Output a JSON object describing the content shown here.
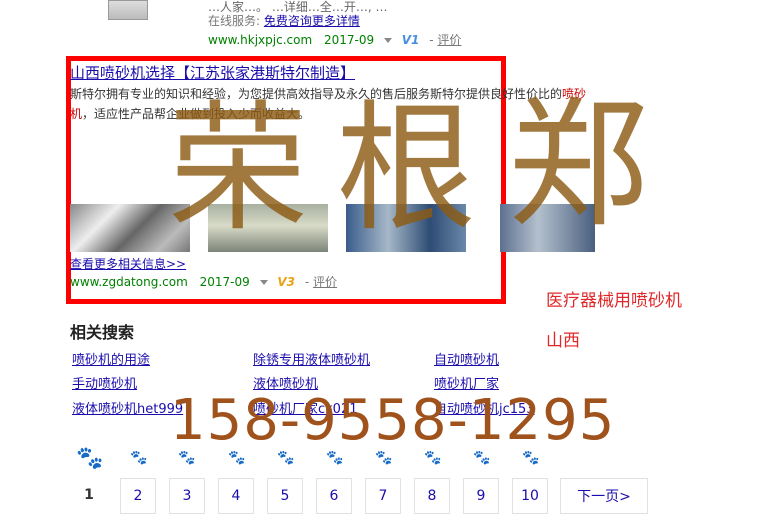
{
  "top_result": {
    "text_line": "…人家…。 …详细…全…开…, …",
    "service_label": "在线服务:",
    "service_link": "免费咨询更多详情",
    "url": "www.hkjxpjc.com",
    "date": "2017-09",
    "badge": "V1",
    "comment": "评价"
  },
  "result": {
    "title": "山西喷砂机选择【江苏张家港斯特尔制造】",
    "desc_part1": "斯特尔拥有专业的知识和经验，为您提供高效指导及永久的售后服务斯特尔提供良好性价比的",
    "desc_keyword": "喷砂机",
    "desc_part2": "，适应性产品帮企业做到投入少而收益大。",
    "more_link": "查看更多相关信息>>",
    "url": "www.zgdatong.com",
    "date": "2017-09",
    "badge": "V3",
    "comment": "评价"
  },
  "seal_chars": [
    "荣",
    "根",
    "郑"
  ],
  "side_text": [
    "医疗器械用喷砂机",
    "山西"
  ],
  "related": {
    "title": "相关搜索",
    "items": [
      "喷砂机的用途",
      "除锈专用液体喷砂机",
      "自动喷砂机",
      "手动喷砂机",
      "液体喷砂机",
      "喷砂机厂家",
      "液体喷砂机het999",
      "喷砂机厂家ck021",
      "自动喷砂机jc153"
    ]
  },
  "phone": "158-9558-1295",
  "pagination": {
    "logo": "du",
    "current": "1",
    "pages": [
      "2",
      "3",
      "4",
      "5",
      "6",
      "7",
      "8",
      "9",
      "10"
    ],
    "next": "下一页>"
  },
  "colors": {
    "link": "#1a0dab",
    "frame": "#ff0000",
    "watermark": "#a0521c",
    "side": "#e0282a"
  }
}
